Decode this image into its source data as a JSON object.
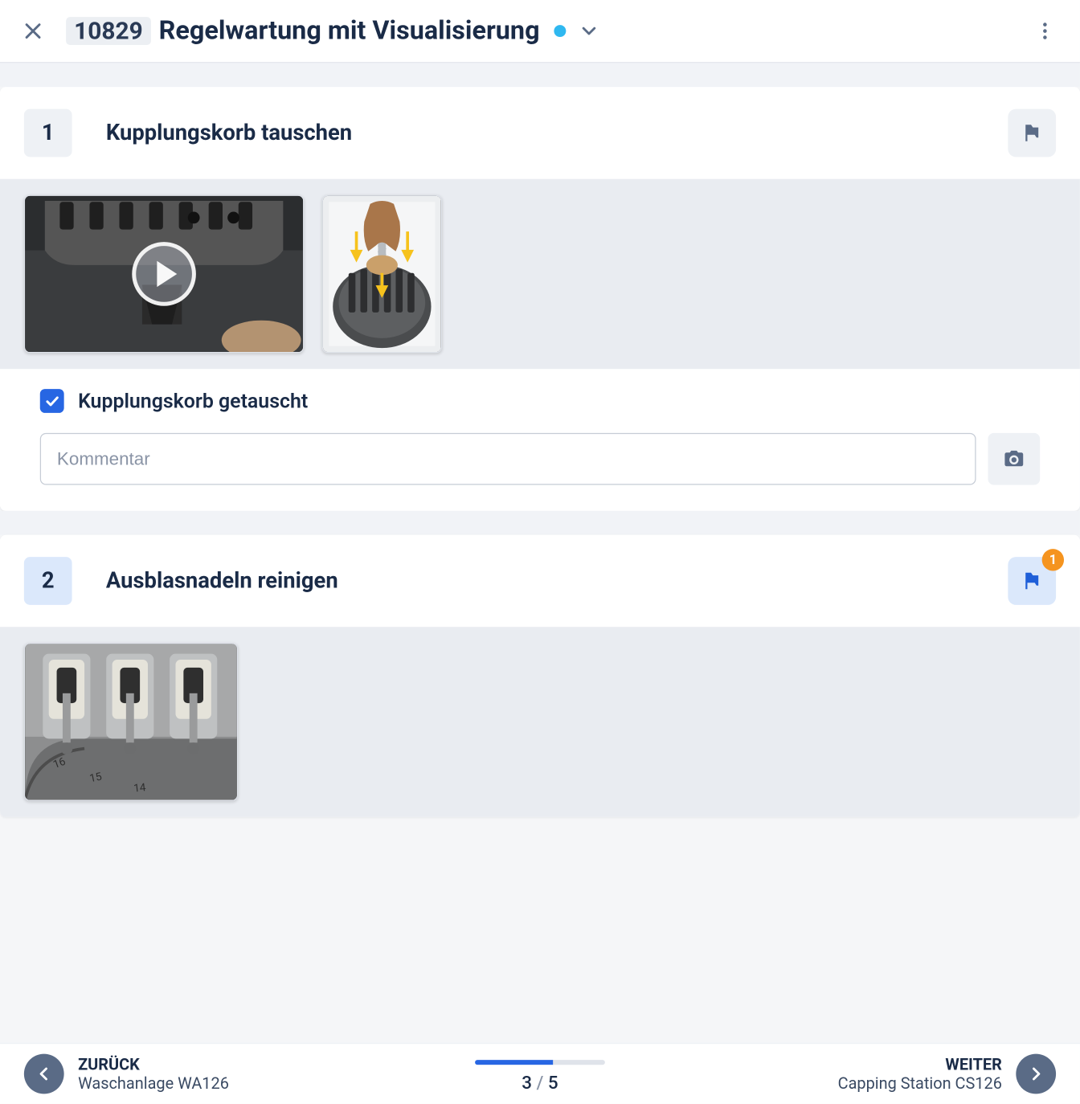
{
  "header": {
    "id": "10829",
    "title": "Regelwartung mit Visualisierung",
    "status_color": "#2fb8f0"
  },
  "steps": [
    {
      "number": "1",
      "title": "Kupplungskorb tauschen",
      "flag_active": false,
      "flag_count": null,
      "checkbox_label": "Kupplungskorb getauscht",
      "checkbox_checked": true,
      "comment_placeholder": "Kommentar"
    },
    {
      "number": "2",
      "title": "Ausblasnadeln reinigen",
      "flag_active": true,
      "flag_count": "1"
    }
  ],
  "footer": {
    "back_label": "ZURÜCK",
    "back_sub": "Waschanlage WA126",
    "next_label": "WEITER",
    "next_sub": "Capping Station CS126",
    "page_current": "3",
    "page_sep": " / ",
    "page_total": "5"
  }
}
